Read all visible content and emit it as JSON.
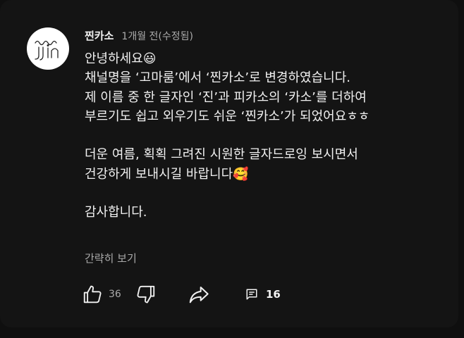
{
  "comment": {
    "author": "찐카소",
    "timestamp": "1개월 전(수정됨)",
    "avatar_icon": "jjin-logo",
    "text": "안녕하세요😃\n채널명을 ‘고마룸’에서 ‘찐카소’로 변경하였습니다.\n제 이름 중 한 글자인 ‘진’과 피카소의 ‘카소’를 더하여\n부르기도 쉽고 외우기도 쉬운 ‘찐카소’가 되었어요ㅎㅎ\n\n더운 여름, 획획 그려진 시원한 글자드로잉 보시면서\n건강하게 보내시길 바랍니다🥰\n\n감사합니다.",
    "collapse_label": "간략히 보기",
    "like_count": "36",
    "reply_count": "16"
  },
  "icons": {
    "like": "thumbs-up-icon",
    "dislike": "thumbs-down-icon",
    "share": "share-arrow-icon",
    "replies": "comment-icon"
  },
  "colors": {
    "background": "#0f0f0f",
    "card": "#141414",
    "primary_text": "#f1f1f1",
    "secondary_text": "#aaaaaa"
  }
}
